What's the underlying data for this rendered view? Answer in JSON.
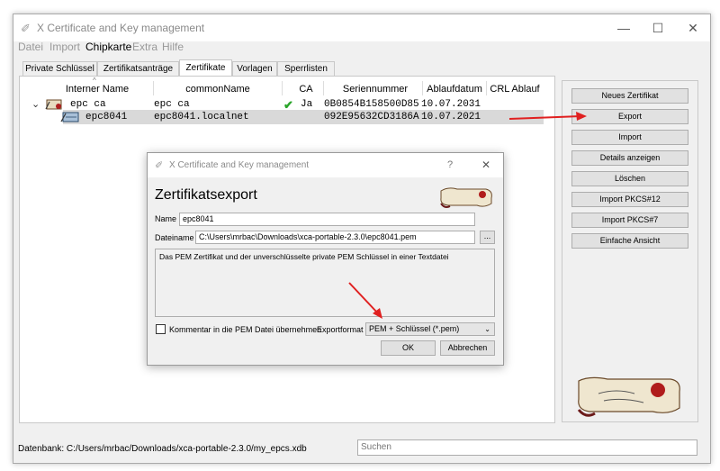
{
  "window": {
    "title": "X Certificate and Key management",
    "controls": [
      "—",
      "☐",
      "✕"
    ]
  },
  "menu": [
    "Datei",
    "Import",
    "Chipkarte",
    "Extra",
    "Hilfe"
  ],
  "tabs": [
    "Private Schlüssel",
    "Zertifikatsanträge",
    "Zertifikate",
    "Vorlagen",
    "Sperrlisten"
  ],
  "table": {
    "headers": [
      "Interner Name",
      "commonName",
      "CA",
      "Seriennummer",
      "Ablaufdatum",
      "CRL Ablauf"
    ],
    "rows": [
      {
        "name": "epc ca",
        "common_name": "epc ca",
        "ca": "Ja",
        "serial": "0B0854B158500D85",
        "expiry": "10.07.2031"
      },
      {
        "name": "epc8041",
        "common_name": "epc8041.localnet",
        "ca": "",
        "serial": "092E95632CD3186A",
        "expiry": "10.07.2021"
      }
    ]
  },
  "sidebar": [
    "Neues Zertifikat",
    "Export",
    "Import",
    "Details anzeigen",
    "Löschen",
    "Import PKCS#12",
    "Import PKCS#7",
    "Einfache Ansicht"
  ],
  "status": {
    "database": "Datenbank: C:/Users/mrbac/Downloads/xca-portable-2.3.0/my_epcs.xdb",
    "search_placeholder": "Suchen"
  },
  "dialog": {
    "title": "X Certificate and Key management",
    "help": "?",
    "close": "✕",
    "heading": "Zertifikatsexport",
    "name_label": "Name",
    "name_value": "epc8041",
    "file_label": "Dateiname",
    "file_value": "C:\\Users\\mrbac\\Downloads\\xca-portable-2.3.0\\epc8041.pem",
    "browse": "...",
    "description": "Das PEM Zertifikat und der unverschlüsselte private PEM Schlüssel in einer Textdatei",
    "comment_label": "Kommentar in die PEM Datei übernehmen",
    "format_label": "Exportformat",
    "format_value": "PEM + Schlüssel (*.pem)",
    "ok": "OK",
    "cancel": "Abbrechen"
  },
  "colors": {
    "arrow": "#e02020",
    "check": "#2aa52a",
    "selection": "#d9d9d9"
  }
}
